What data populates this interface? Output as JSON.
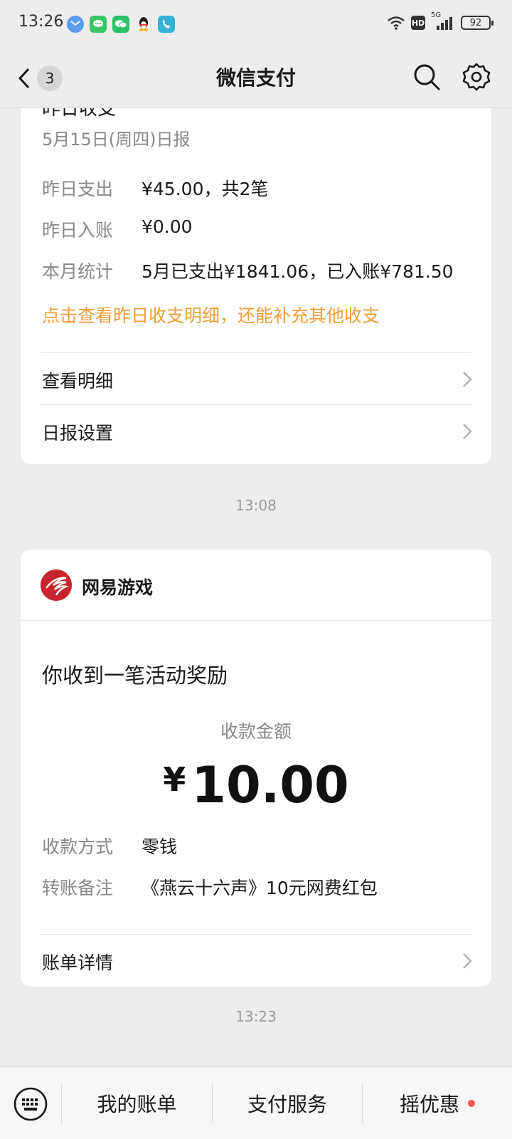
{
  "status": {
    "time": "13:26",
    "battery": "92",
    "network": "5G",
    "hd": "HD"
  },
  "nav": {
    "title": "微信支付",
    "unread_count": "3"
  },
  "report": {
    "partial_title": "昨日收支",
    "date": "5月15日(周四)日报",
    "rows": [
      {
        "label": "昨日支出",
        "value": "¥45.00，共2笔"
      },
      {
        "label": "昨日入账",
        "value": "¥0.00"
      },
      {
        "label": "本月统计",
        "value": "5月已支出¥1841.06，已入账¥781.50"
      }
    ],
    "hint_link": "点击查看昨日收支明细，还能补充其他收支",
    "view_details": "查看明细",
    "report_settings": "日报设置"
  },
  "time_sep_1": "13:08",
  "reward": {
    "brand": "网易游戏",
    "title": "你收到一笔活动奖励",
    "amount_label": "收款金额",
    "currency": "¥",
    "amount": "10.00",
    "rows": [
      {
        "label": "收款方式",
        "value": "零钱"
      },
      {
        "label": "转账备注",
        "value": "《燕云十六声》10元网费红包"
      }
    ],
    "bill_details": "账单详情"
  },
  "time_sep_2": "13:23",
  "bottom": {
    "tab1": "我的账单",
    "tab2": "支付服务",
    "tab3": "摇优惠"
  },
  "colors": {
    "accent_orange": "#f29c38",
    "brand_red": "#c8242b",
    "badge_red": "#fa5151",
    "bg": "#ededed"
  }
}
